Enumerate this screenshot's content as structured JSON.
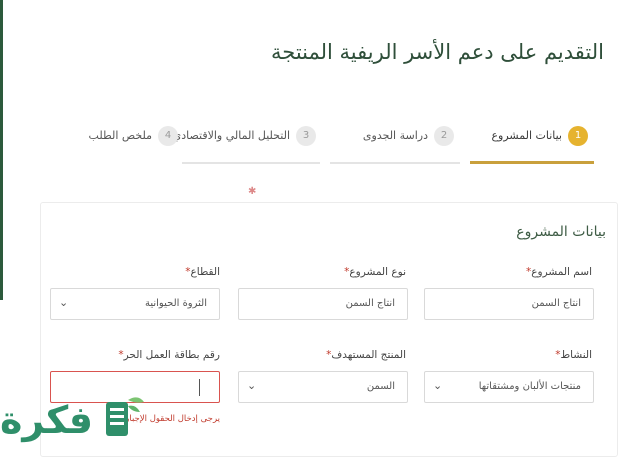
{
  "page": {
    "title": "التقديم على دعم الأسر الريفية المنتجة"
  },
  "steps": [
    {
      "number": "1",
      "label": "بيانات المشروع",
      "active": true
    },
    {
      "number": "2",
      "label": "دراسة الجدوى",
      "active": false
    },
    {
      "number": "3",
      "label": "التحليل المالي والاقتصادي",
      "active": false
    },
    {
      "number": "4",
      "label": "ملخص الطلب",
      "active": false
    }
  ],
  "form": {
    "section_title": "بيانات المشروع",
    "fields": {
      "project_name": {
        "label": "اسم المشروع",
        "value": "انتاج السمن"
      },
      "project_type": {
        "label": "نوع المشروع",
        "value": "انتاج السمن"
      },
      "sector": {
        "label": "القطاع",
        "value": "الثروة الحيوانية"
      },
      "activity": {
        "label": "النشاط",
        "value": "منتجات الألبان ومشتقاتها"
      },
      "target_product": {
        "label": "المنتج المستهدف",
        "value": "السمن"
      },
      "freelance_card": {
        "label": "رقم بطاقة العمل الحر",
        "value": "",
        "error_hint": "يرجى إدخال الحقول الإجبارية"
      }
    },
    "required_mark": "*"
  },
  "watermark": {
    "text": "فكرة"
  },
  "colors": {
    "accent": "#e6b32f",
    "active_bar": "#c9a03c",
    "title": "#2f4f3a",
    "error": "#d9534f",
    "logo": "#2f8f6a"
  }
}
